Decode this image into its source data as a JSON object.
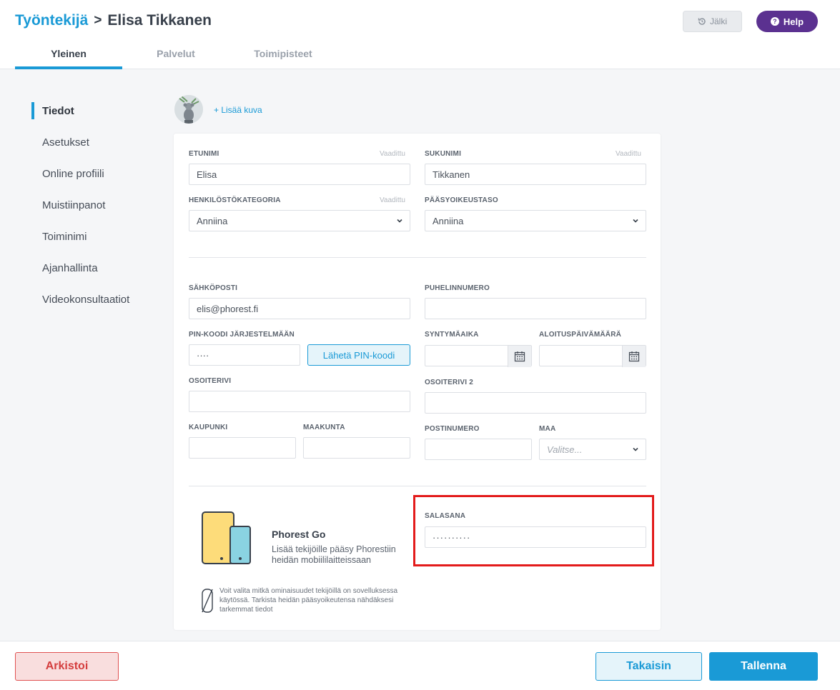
{
  "breadcrumb": {
    "parent": "Työntekijä",
    "separator": ">",
    "current": "Elisa Tikkanen"
  },
  "header_buttons": {
    "history": "Jälki",
    "help": "Help"
  },
  "tabs": [
    "Yleinen",
    "Palvelut",
    "Toimipisteet"
  ],
  "sidebar": [
    "Tiedot",
    "Asetukset",
    "Online profiili",
    "Muistiinpanot",
    "Toiminimi",
    "Ajanhallinta",
    "Videokonsultaatiot"
  ],
  "photo": {
    "add_label": "+ Lisää kuva"
  },
  "form": {
    "required_text": "Vaadittu",
    "first_name": {
      "label": "ETUNIMI",
      "value": "Elisa"
    },
    "last_name": {
      "label": "SUKUNIMI",
      "value": "Tikkanen"
    },
    "staff_category": {
      "label": "HENKILÖSTÖKATEGORIA",
      "value": "Anniina"
    },
    "access_level": {
      "label": "PÄÄSYOIKEUSTASO",
      "value": "Anniina"
    },
    "email": {
      "label": "SÄHKÖPOSTI",
      "value": "elis@phorest.fi"
    },
    "phone": {
      "label": "PUHELINNUMERO",
      "value": ""
    },
    "pin": {
      "label": "PIN-KOODI JÄRJESTELMÄÄN",
      "value": "····",
      "button": "Lähetä PIN-koodi"
    },
    "birthdate": {
      "label": "SYNTYMÄAIKA",
      "value": ""
    },
    "start_date": {
      "label": "ALOITUSPÄIVÄMÄÄRÄ",
      "value": ""
    },
    "address1": {
      "label": "OSOITERIVI",
      "value": ""
    },
    "address2": {
      "label": "OSOITERIVI 2",
      "value": ""
    },
    "city": {
      "label": "KAUPUNKI",
      "value": ""
    },
    "region": {
      "label": "MAAKUNTA",
      "value": ""
    },
    "postcode": {
      "label": "POSTINUMERO",
      "value": ""
    },
    "country": {
      "label": "MAA",
      "placeholder": "Valitse..."
    },
    "password": {
      "label": "SALASANA",
      "value": "··········"
    }
  },
  "phorest_go": {
    "title": "Phorest Go",
    "description": "Lisää tekijöille pääsy Phorestiin heidän mobiililaitteissaan",
    "note": "Voit valita mitkä ominaisuudet tekijöillä on sovelluksessa käytössä. Tarkista heidän pääsyoikeutensa nähdäksesi tarkemmat tiedot"
  },
  "footer": {
    "archive": "Arkistoi",
    "back": "Takaisin",
    "save": "Tallenna"
  },
  "colors": {
    "accent": "#1a9ad6",
    "help": "#5b3190",
    "danger": "#e05252",
    "highlight": "#e31b1b"
  }
}
